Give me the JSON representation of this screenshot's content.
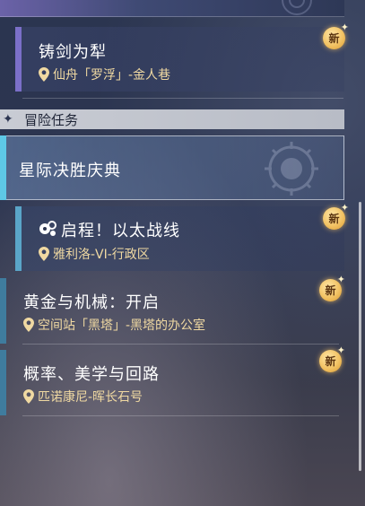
{
  "quests_top": [
    {
      "title": "铸剑为犁",
      "location": "仙舟「罗浮」-金人巷",
      "badge": "新"
    }
  ],
  "section": {
    "label": "冒险任务"
  },
  "category": {
    "title": "星际决胜庆典"
  },
  "quests": [
    {
      "title": "启程！以太战线",
      "location": "雅利洛-VI-行政区",
      "badge": "新"
    },
    {
      "title": "黄金与机械：开启",
      "location": "空间站「黑塔」-黑塔的办公室",
      "badge": "新"
    },
    {
      "title": "概率、美学与回路",
      "location": "匹诺康尼-晖长石号",
      "badge": "新"
    }
  ],
  "colors": {
    "accent_purple": "#7b6fc8",
    "accent_teal": "#5aa5c8",
    "location_text": "#f0d9a2",
    "badge_gold": "#f2c263"
  },
  "icons": {
    "location": "location-pin-icon",
    "new": "new-badge-icon",
    "category": "diamond-icon",
    "quest_type": "aether-controller-icon"
  }
}
